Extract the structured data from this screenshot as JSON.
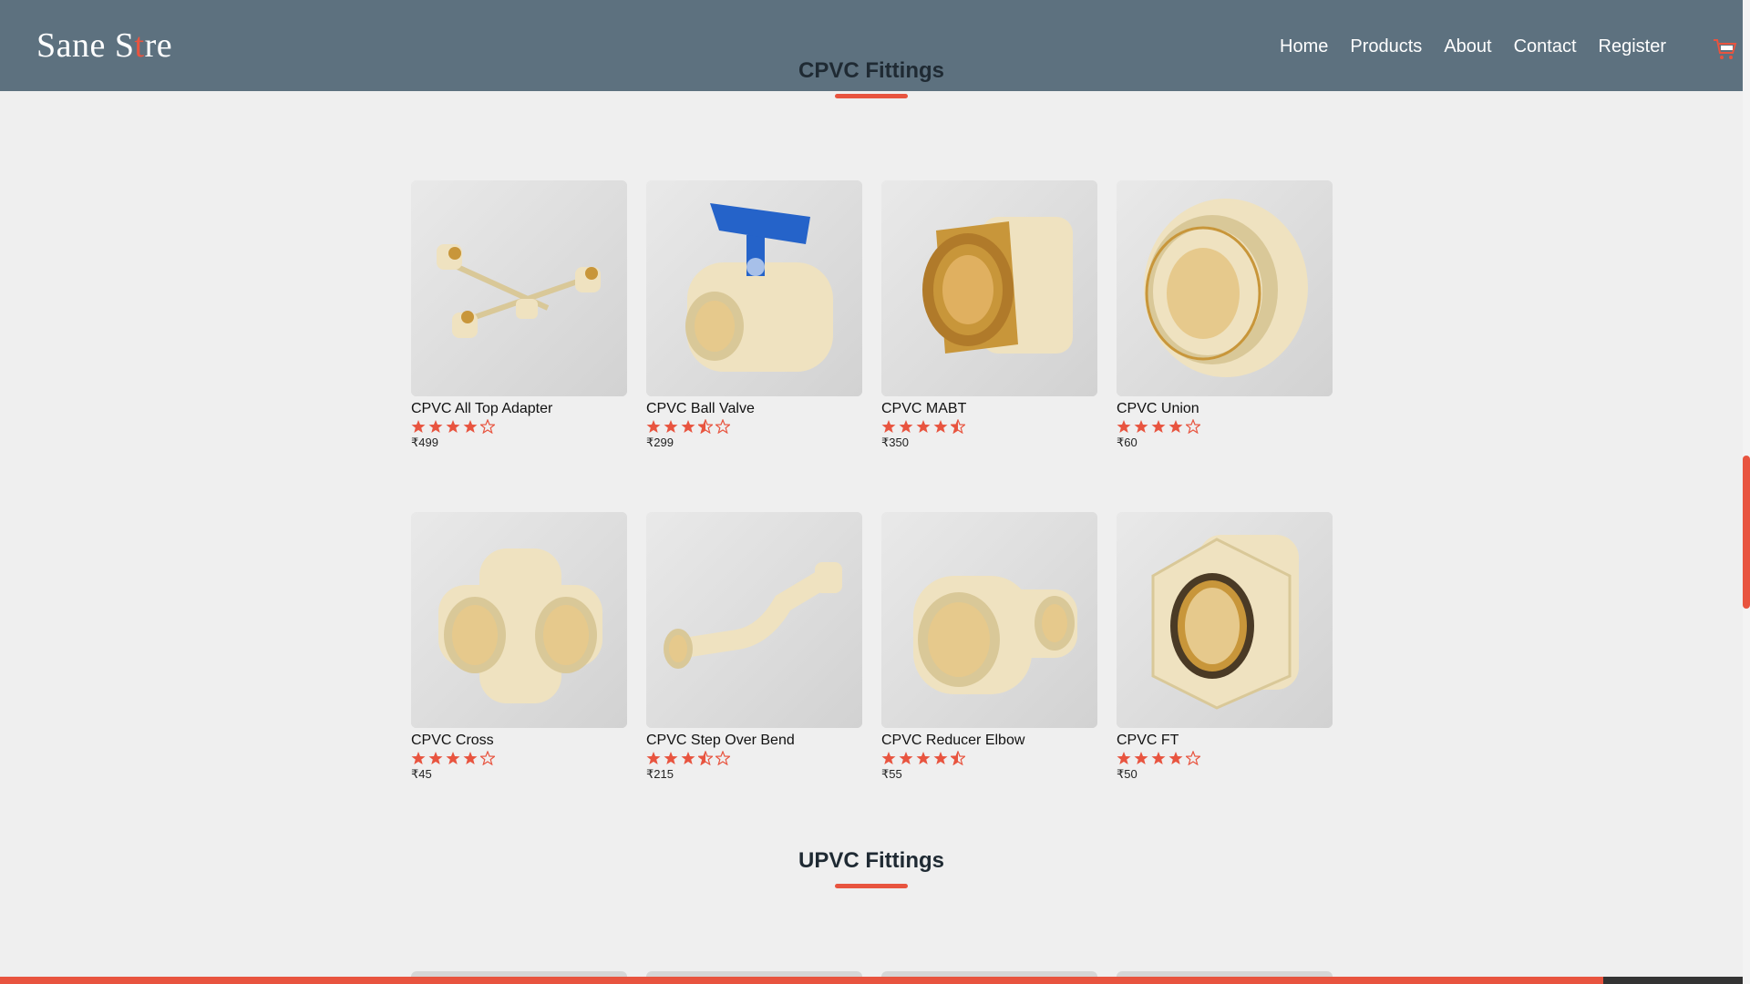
{
  "header": {
    "logo_prefix": "Sane S",
    "logo_mid": "t",
    "logo_suffix": "re",
    "nav": [
      "Home",
      "Products",
      "About",
      "Contact",
      "Register"
    ]
  },
  "sections": [
    {
      "title": "CPVC Fittings",
      "products": [
        {
          "name": "CPVC All Top Adapter",
          "rating": 4,
          "price": "₹499",
          "icon": "all-top-adapter"
        },
        {
          "name": "CPVC Ball Valve",
          "rating": 3.5,
          "price": "₹299",
          "icon": "ball-valve"
        },
        {
          "name": "CPVC MABT",
          "rating": 4.5,
          "price": "₹350",
          "icon": "mabt"
        },
        {
          "name": "CPVC Union",
          "rating": 4,
          "price": "₹60",
          "icon": "union"
        },
        {
          "name": "CPVC Cross",
          "rating": 4,
          "price": "₹45",
          "icon": "cross"
        },
        {
          "name": "CPVC Step Over Bend",
          "rating": 3.5,
          "price": "₹215",
          "icon": "step-over-bend"
        },
        {
          "name": "CPVC Reducer Elbow",
          "rating": 4.5,
          "price": "₹55",
          "icon": "reducer-elbow"
        },
        {
          "name": "CPVC FT",
          "rating": 4,
          "price": "₹50",
          "icon": "ft"
        }
      ]
    },
    {
      "title": "UPVC Fittings",
      "products": []
    }
  ],
  "scroll_progress": 0.92,
  "colors": {
    "accent": "#e8543f",
    "navbar": "#5d717f",
    "background": "#efefef",
    "pipe": "#efe2c0",
    "valve_handle": "#2563c9",
    "brass": "#c8963a"
  }
}
